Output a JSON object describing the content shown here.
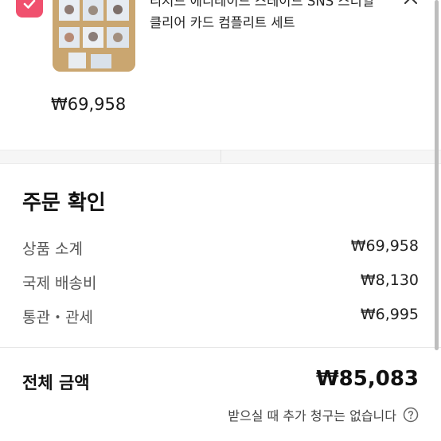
{
  "product": {
    "title_line1": "리저드 에디레이드 스테이드 SNS 스티일",
    "title_line2": "클리어 카드 컴플리트 세트",
    "price": "₩69,958"
  },
  "order_summary": {
    "title": "주문 확인",
    "rows": [
      {
        "label": "상품 소계",
        "value": "₩69,958"
      },
      {
        "label": "국제 배송비",
        "value": "₩8,130"
      },
      {
        "label": "통관・관세",
        "value": "₩6,995"
      }
    ],
    "total_label": "전체 금액",
    "total_value": "₩85,083",
    "note": "받으실 때 추가 청구는 없습니다"
  },
  "colors": {
    "checkbox": "#f0506e",
    "thumbnail_bg": "#caa670"
  },
  "icons": {
    "checkbox": "check-icon",
    "close": "close-icon",
    "help": "help-icon"
  }
}
